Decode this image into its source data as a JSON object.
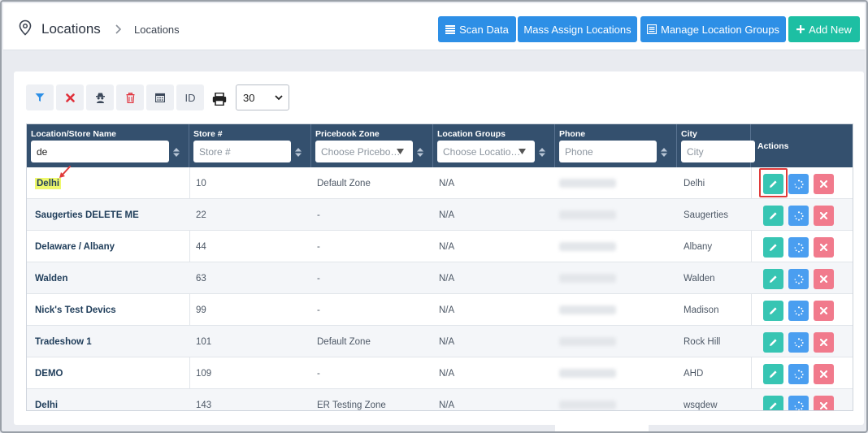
{
  "header": {
    "title": "Locations",
    "breadcrumb": "Locations",
    "buttons": {
      "scan_data": "Scan Data",
      "mass_assign": "Mass Assign Locations",
      "manage_groups": "Manage Location Groups",
      "add_new": "Add New"
    }
  },
  "toolbar": {
    "id_label": "ID",
    "page_size": "30"
  },
  "table": {
    "columns": {
      "name": "Location/Store Name",
      "store": "Store #",
      "pricebook": "Pricebook Zone",
      "groups": "Location Groups",
      "phone": "Phone",
      "city": "City",
      "actions": "Actions"
    },
    "filters": {
      "name_value": "de",
      "store_placeholder": "Store #",
      "pricebook_placeholder": "Choose Pricebo…",
      "groups_placeholder": "Choose Locatio…",
      "phone_placeholder": "Phone",
      "city_placeholder": "City"
    },
    "rows": [
      {
        "name": "Delhi",
        "store": "10",
        "pricebook": "Default Zone",
        "groups": "N/A",
        "city": "Delhi"
      },
      {
        "name": "Saugerties DELETE ME",
        "store": "22",
        "pricebook": "-",
        "groups": "N/A",
        "city": "Saugerties"
      },
      {
        "name": "Delaware / Albany",
        "store": "44",
        "pricebook": "-",
        "groups": "N/A",
        "city": "Albany"
      },
      {
        "name": "Walden",
        "store": "63",
        "pricebook": "-",
        "groups": "N/A",
        "city": "Walden"
      },
      {
        "name": "Nick's Test Devics",
        "store": "99",
        "pricebook": "-",
        "groups": "N/A",
        "city": "Madison"
      },
      {
        "name": "Tradeshow 1",
        "store": "101",
        "pricebook": "Default Zone",
        "groups": "N/A",
        "city": "Rock Hill"
      },
      {
        "name": "DEMO",
        "store": "109",
        "pricebook": "-",
        "groups": "N/A",
        "city": "AHD"
      },
      {
        "name": "Delhi",
        "store": "143",
        "pricebook": "ER Testing Zone",
        "groups": "N/A",
        "city": "wsqdew"
      }
    ]
  },
  "colors": {
    "header_bg": "#34506e",
    "primary": "#2d8fe6",
    "success": "#1dbfa3",
    "edit": "#37c5b3",
    "delete": "#f17a8c",
    "highlight": "#eef86c",
    "annotation": "#e03a3a"
  },
  "icons": [
    "map-pin-icon",
    "chevron-right-icon",
    "list-icon",
    "plus-icon",
    "filter-icon",
    "clear-icon",
    "spy-icon",
    "trash-icon",
    "calendar-icon",
    "print-icon",
    "pencil-icon",
    "sync-icon",
    "close-icon"
  ]
}
